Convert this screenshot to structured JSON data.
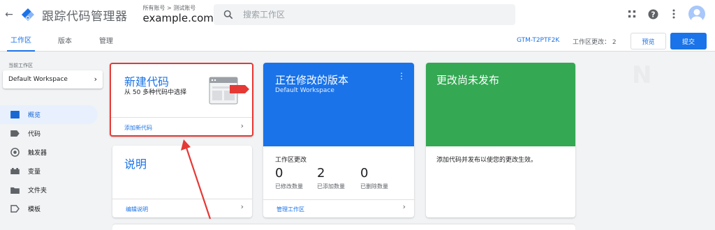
{
  "header": {
    "back_label": "←",
    "app_title": "跟踪代码管理器",
    "breadcrumb": "所有账号 > 测试账号",
    "container_name": "example.com",
    "search_placeholder": "搜索工作区"
  },
  "tabs": {
    "workspace": "工作区",
    "versions": "版本",
    "admin": "管理",
    "container_id": "GTM-T2PTF2K",
    "workspace_changes": "工作区更改：  2",
    "preview_label": "预览",
    "submit_label": "提交"
  },
  "sidebar": {
    "current_workspace_label": "当前工作区",
    "workspace_name": "Default Workspace",
    "items": [
      {
        "label": "概览",
        "icon": "overview-icon",
        "active": true
      },
      {
        "label": "代码",
        "icon": "tag-icon",
        "active": false
      },
      {
        "label": "触发器",
        "icon": "trigger-icon",
        "active": false
      },
      {
        "label": "变量",
        "icon": "variable-icon",
        "active": false
      },
      {
        "label": "文件夹",
        "icon": "folder-icon",
        "active": false
      },
      {
        "label": "模板",
        "icon": "template-icon",
        "active": false
      }
    ]
  },
  "cards": {
    "new_tag": {
      "title": "新建代码",
      "subtitle": "从 50 多种代码中选择",
      "link": "添加新代码"
    },
    "description": {
      "title": "说明",
      "link": "编辑说明"
    },
    "current_version": {
      "title": "正在修改的版本",
      "workspace": "Default Workspace",
      "changes_label": "工作区更改",
      "stats": [
        {
          "value": "0",
          "label": "已修改数量"
        },
        {
          "value": "2",
          "label": "已添加数量"
        },
        {
          "value": "0",
          "label": "已删除数量"
        }
      ],
      "link": "管理工作区"
    },
    "unpublished": {
      "title": "更改尚未发布",
      "message": "添加代码并发布以使您的更改生效。"
    }
  },
  "colors": {
    "primary": "#1a73e8",
    "green": "#34a853",
    "highlight": "#e53935"
  }
}
